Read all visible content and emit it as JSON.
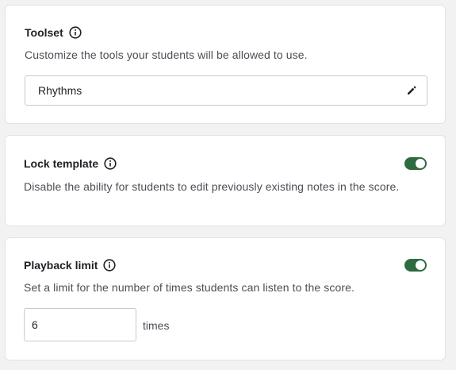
{
  "toolset": {
    "title": "Toolset",
    "description": "Customize the tools your students will be allowed to use.",
    "selected_value": "Rhythms"
  },
  "lock_template": {
    "title": "Lock template",
    "description": "Disable the ability for students to edit previously existing notes in the score.",
    "enabled": true
  },
  "playback_limit": {
    "title": "Playback limit",
    "description": "Set a limit for the number of times students can listen to the score.",
    "enabled": true,
    "value": "6",
    "unit_label": "times"
  },
  "colors": {
    "toggle_on": "#2e6b3f",
    "card_background": "#ffffff",
    "page_background": "#f2f2f3"
  },
  "icons": {
    "info": "info-icon",
    "edit": "pencil-icon"
  }
}
